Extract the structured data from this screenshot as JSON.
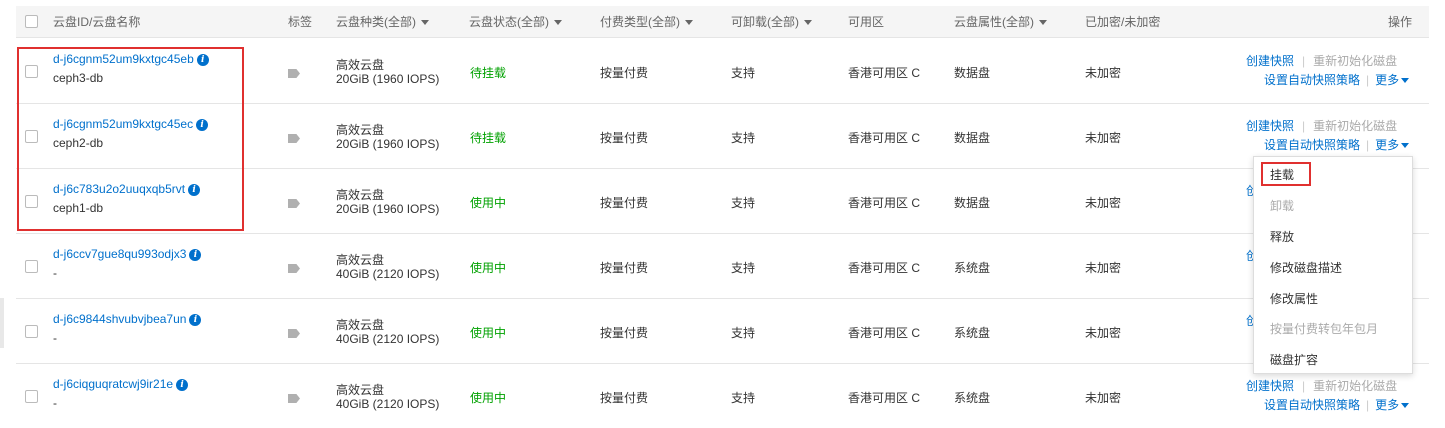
{
  "header": {
    "id_name": "云盘ID/云盘名称",
    "tags": "标签",
    "disk_type": "云盘种类(全部)",
    "disk_status": "云盘状态(全部)",
    "billing": "付费类型(全部)",
    "detachable": "可卸载(全部)",
    "zone": "可用区",
    "disk_attr": "云盘属性(全部)",
    "encrypted": "已加密/未加密",
    "actions": "操作"
  },
  "rows": [
    {
      "id": "d-j6cgnm52um9kxtgc45eb",
      "name": "ceph3-db",
      "type": "高效云盘",
      "size": "20GiB (1960 IOPS)",
      "status": "待挂载",
      "billing": "按量付费",
      "detachable": "支持",
      "zone": "香港可用区 C",
      "attr": "数据盘",
      "encrypted": "未加密",
      "snapshot": "创建快照",
      "reinit": "重新初始化磁盘",
      "policy": "设置自动快照策略",
      "more": "更多"
    },
    {
      "id": "d-j6cgnm52um9kxtgc45ec",
      "name": "ceph2-db",
      "type": "高效云盘",
      "size": "20GiB (1960 IOPS)",
      "status": "待挂载",
      "billing": "按量付费",
      "detachable": "支持",
      "zone": "香港可用区 C",
      "attr": "数据盘",
      "encrypted": "未加密",
      "snapshot": "创建快照",
      "reinit": "重新初始化磁盘",
      "policy": "设置自动快照策略",
      "more": "更多"
    },
    {
      "id": "d-j6c783u2o2uuqxqb5rvt",
      "name": "ceph1-db",
      "type": "高效云盘",
      "size": "20GiB (1960 IOPS)",
      "status": "使用中",
      "billing": "按量付费",
      "detachable": "支持",
      "zone": "香港可用区 C",
      "attr": "数据盘",
      "encrypted": "未加密",
      "snapshot": "创",
      "reinit": "",
      "policy": "",
      "more": ""
    },
    {
      "id": "d-j6ccv7gue8qu993odjx3",
      "name": "-",
      "type": "高效云盘",
      "size": "40GiB (2120 IOPS)",
      "status": "使用中",
      "billing": "按量付费",
      "detachable": "支持",
      "zone": "香港可用区 C",
      "attr": "系统盘",
      "encrypted": "未加密",
      "snapshot": "创",
      "reinit": "",
      "policy": "",
      "more": ""
    },
    {
      "id": "d-j6c9844shvubvjbea7un",
      "name": "-",
      "type": "高效云盘",
      "size": "40GiB (2120 IOPS)",
      "status": "使用中",
      "billing": "按量付费",
      "detachable": "支持",
      "zone": "香港可用区 C",
      "attr": "系统盘",
      "encrypted": "未加密",
      "snapshot": "创",
      "reinit": "",
      "policy": "",
      "more": ""
    },
    {
      "id": "d-j6ciqguqratcwj9ir21e",
      "name": "-",
      "type": "高效云盘",
      "size": "40GiB (2120 IOPS)",
      "status": "使用中",
      "billing": "按量付费",
      "detachable": "支持",
      "zone": "香港可用区 C",
      "attr": "系统盘",
      "encrypted": "未加密",
      "snapshot": "创建快照",
      "reinit": "重新初始化磁盘",
      "policy": "设置自动快照策略",
      "more": "更多"
    }
  ],
  "dropdown": {
    "items": [
      "挂载",
      "卸载",
      "释放",
      "修改磁盘描述",
      "修改属性",
      "按量付费转包年包月",
      "磁盘扩容"
    ],
    "disabled": [
      false,
      true,
      false,
      false,
      false,
      true,
      false
    ]
  },
  "colors": {
    "link": "#0070cc",
    "status_green": "#00a100",
    "highlight": "#e0302f",
    "disabled": "#aaaaaa"
  },
  "icons": {
    "info": "info-icon",
    "tag": "tag-icon",
    "caret": "chevron-down-icon"
  }
}
